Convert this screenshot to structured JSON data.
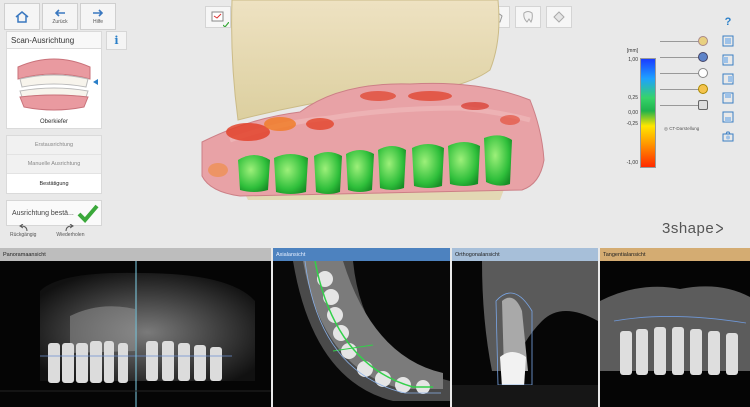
{
  "nav": {
    "back_label": "Zurück",
    "help_label": "Hilfe"
  },
  "panel": {
    "title": "Scan-Ausrichtung",
    "jaw_caption": "Oberkiefer",
    "steps": [
      "Erstausrichtung",
      "Manuelle Ausrichtung",
      "Bestätigung"
    ],
    "confirm_label": "Ausrichtung bestä...",
    "undo_label": "Rückgängig",
    "redo_label": "Wiederholen"
  },
  "legend": {
    "unit": "[mm]",
    "ticks": [
      "1,00",
      "0,25",
      "0,00",
      "-0,25",
      "-1,00"
    ],
    "ct_label": "CT-Darstellung"
  },
  "brand": "3shape",
  "views": {
    "panorama": "Panoramaansicht",
    "axial": "Axialansicht",
    "ortho": "Orthogonalansicht",
    "tangent": "Tangentialansicht"
  },
  "colors": {
    "accent": "#2a7fc8",
    "check": "#3aa83a",
    "axial_bar": "#4d82bf",
    "ortho_bar": "#a7bfd9",
    "tangent_bar": "#d4ac72",
    "panorama_bar": "#bdbdbd"
  }
}
